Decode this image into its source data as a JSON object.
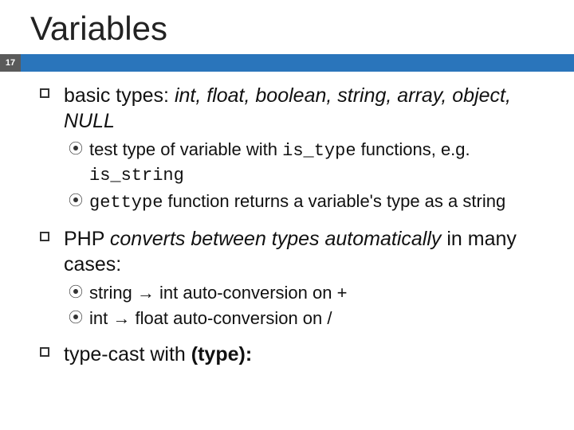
{
  "slide": {
    "title": "Variables",
    "page_number": "17",
    "bullets": [
      {
        "pre": "basic types: ",
        "emph": "int, float, boolean, string, array, object, NULL",
        "sub": [
          {
            "t1": "test type of variable with ",
            "c1": "is_type",
            "t2": " functions, e.g. ",
            "c2": "is_string",
            "t3": ""
          },
          {
            "t1": "",
            "c1": "gettype",
            "t2": " function returns a variable's type as a string",
            "c2": "",
            "t3": ""
          }
        ]
      },
      {
        "pre": "PHP ",
        "emph": "converts between types automatically",
        "post": " in many cases:",
        "sub": [
          {
            "t1": "string → int auto-conversion on +",
            "c1": "",
            "t2": "",
            "c2": "",
            "t3": ""
          },
          {
            "t1": "int → float auto-conversion on /",
            "c1": "",
            "t2": "",
            "c2": "",
            "t3": ""
          }
        ]
      },
      {
        "pre": "type-cast with ",
        "strong": "(type):",
        "sub": []
      }
    ]
  }
}
